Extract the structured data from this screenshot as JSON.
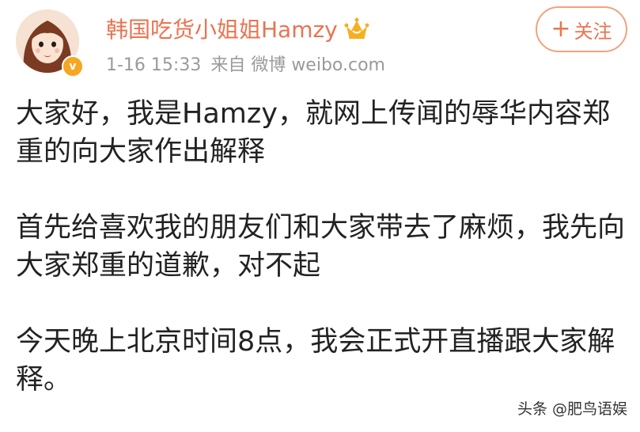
{
  "header": {
    "username": "韩国吃货小姐姐Hamzy",
    "timestamp": "1-16 15:33",
    "source": "来自 微博 weibo.com",
    "follow_label": "关注",
    "follow_icon": "plus-icon",
    "badge_icon": "crown-icon",
    "verified_icon": "verified-v-icon",
    "verified_label": "v"
  },
  "post": {
    "paragraphs": [
      "大家好，我是Hamzy，就网上传闻的辱华内容郑重的向大家作出解释",
      "首先给喜欢我的朋友们和大家带去了麻烦，我先向大家郑重的道歉，对不起",
      "今天晚上北京时间8点，我会正式开直播跟大家解释。"
    ]
  },
  "watermark": "头条 @肥鸟语娱",
  "colors": {
    "accent": "#eb7350",
    "meta": "#9a9a9a",
    "text": "#222222",
    "verified": "#f5a623",
    "crown": "#f5b021"
  }
}
